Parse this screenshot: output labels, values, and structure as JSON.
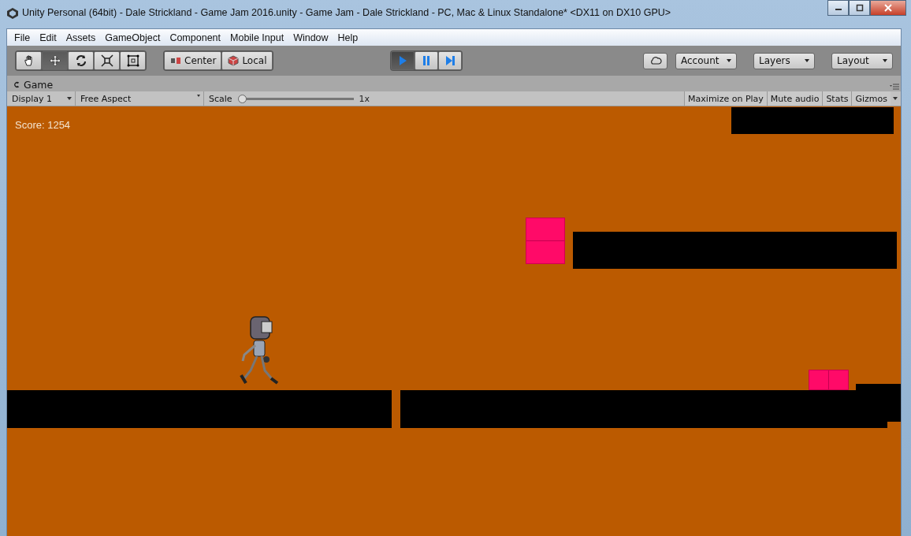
{
  "window": {
    "title": "Unity Personal (64bit) - Dale Strickland - Game Jam 2016.unity - Game Jam - Dale Strickland - PC, Mac & Linux Standalone* <DX11 on DX10 GPU>"
  },
  "menu": [
    "File",
    "Edit",
    "Assets",
    "GameObject",
    "Component",
    "Mobile Input",
    "Window",
    "Help"
  ],
  "tools": [
    {
      "kind": "hand",
      "selected": false
    },
    {
      "kind": "move",
      "selected": true
    },
    {
      "kind": "rotate",
      "selected": false
    },
    {
      "kind": "scale",
      "selected": false
    },
    {
      "kind": "rect",
      "selected": false
    }
  ],
  "pivot": [
    {
      "kind": "center",
      "label": "Center"
    },
    {
      "kind": "local",
      "label": "Local"
    }
  ],
  "playback": [
    {
      "kind": "play",
      "selected": true
    },
    {
      "kind": "pause",
      "selected": false
    },
    {
      "kind": "step",
      "selected": false
    }
  ],
  "right_buttons": [
    {
      "kind": "cloud"
    },
    {
      "kind": "dropdown",
      "label": "Account"
    },
    {
      "kind": "dropdown",
      "label": "Layers"
    },
    {
      "kind": "dropdown",
      "label": "Layout"
    }
  ],
  "game_tab": {
    "label": "Game"
  },
  "game_toolbar": {
    "display": "Display 1",
    "aspect": "Free Aspect",
    "scale_label": "Scale",
    "scale": {
      "level": 0
    },
    "scale_value": "1x",
    "toggles": [
      {
        "label": "Maximize on Play",
        "selected": false
      },
      {
        "label": "Mute audio",
        "selected": false
      },
      {
        "label": "Stats",
        "selected": false
      },
      {
        "label": "Gizmos",
        "selected": false
      }
    ]
  },
  "game": {
    "score": "Score: 1254"
  }
}
